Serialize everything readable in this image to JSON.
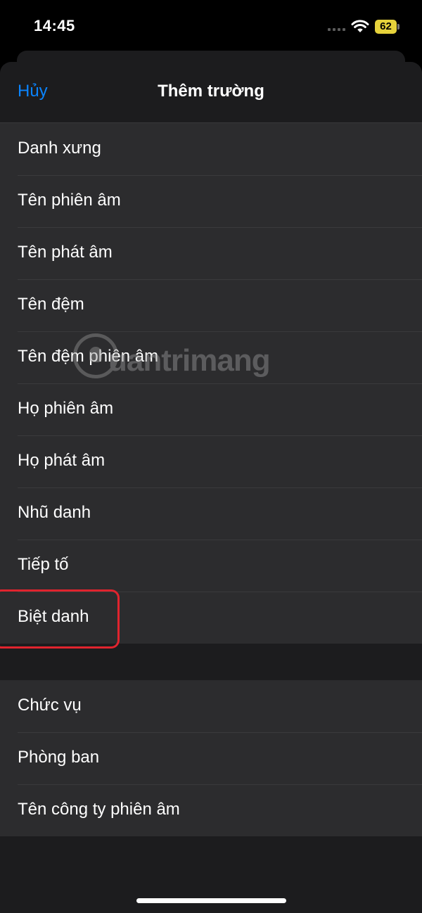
{
  "status_bar": {
    "time": "14:45",
    "battery": "62"
  },
  "header": {
    "cancel_label": "Hủy",
    "title": "Thêm trường"
  },
  "group1": [
    "Danh xưng",
    "Tên phiên âm",
    "Tên phát âm",
    "Tên đệm",
    "Tên đệm phiên âm",
    "Họ phiên âm",
    "Họ phát âm",
    "Nhũ danh",
    "Tiếp tố",
    "Biệt danh"
  ],
  "group2": [
    "Chức vụ",
    "Phòng ban",
    "Tên công ty phiên âm"
  ],
  "watermark": {
    "text": "uantrimang"
  },
  "colors": {
    "accent": "#0a84ff",
    "highlight": "#e0242e",
    "battery": "#e6d23b"
  }
}
